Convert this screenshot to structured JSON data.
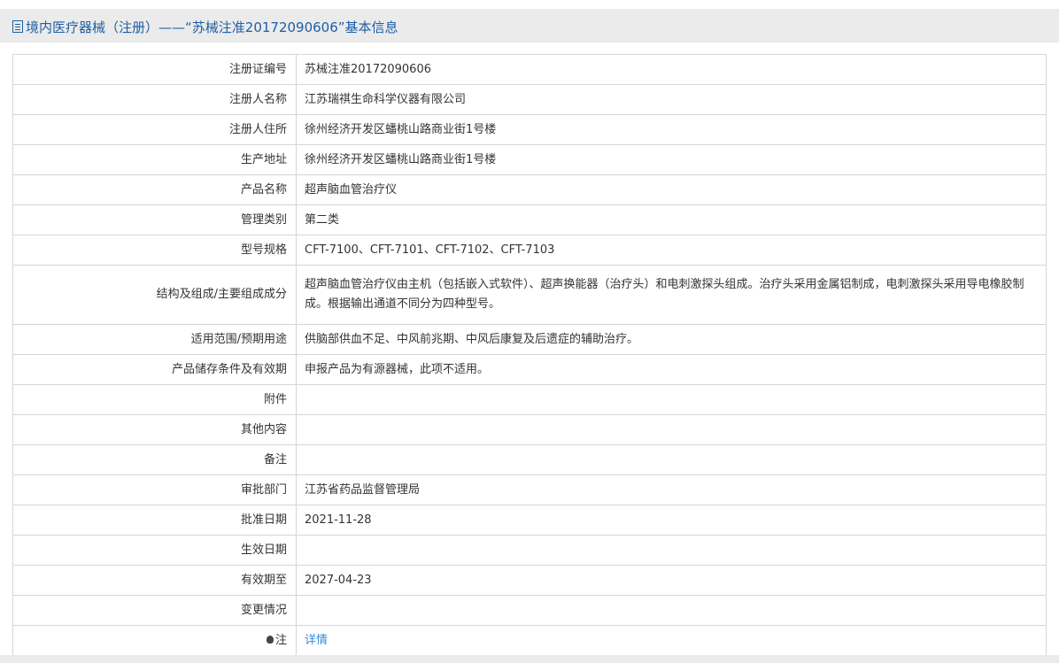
{
  "header": {
    "title": "境内医疗器械（注册）——“苏械注准20172090606”基本信息"
  },
  "rows": [
    {
      "label": "注册证编号",
      "value": "苏械注准20172090606"
    },
    {
      "label": "注册人名称",
      "value": "江苏瑞祺生命科学仪器有限公司"
    },
    {
      "label": "注册人住所",
      "value": "徐州经济开发区蟠桃山路商业街1号楼"
    },
    {
      "label": "生产地址",
      "value": "徐州经济开发区蟠桃山路商业街1号楼"
    },
    {
      "label": "产品名称",
      "value": "超声脑血管治疗仪"
    },
    {
      "label": "管理类别",
      "value": "第二类"
    },
    {
      "label": "型号规格",
      "value": "CFT-7100、CFT-7101、CFT-7102、CFT-7103"
    },
    {
      "label": "结构及组成/主要组成成分",
      "value": "超声脑血管治疗仪由主机（包括嵌入式软件）、超声换能器（治疗头）和电刺激探头组成。治疗头采用金属铝制成，电刺激探头采用导电橡胶制成。根据输出通道不同分为四种型号。"
    },
    {
      "label": "适用范围/预期用途",
      "value": "供脑部供血不足、中风前兆期、中风后康复及后遗症的辅助治疗。"
    },
    {
      "label": "产品储存条件及有效期",
      "value": "申报产品为有源器械，此项不适用。"
    },
    {
      "label": "附件",
      "value": ""
    },
    {
      "label": "其他内容",
      "value": ""
    },
    {
      "label": "备注",
      "value": ""
    },
    {
      "label": "审批部门",
      "value": "江苏省药品监督管理局"
    },
    {
      "label": "批准日期",
      "value": "2021-11-28"
    },
    {
      "label": "生效日期",
      "value": ""
    },
    {
      "label": "有效期至",
      "value": "2027-04-23"
    },
    {
      "label": "变更情况",
      "value": ""
    }
  ],
  "note": {
    "label": "注",
    "link": "详情"
  }
}
